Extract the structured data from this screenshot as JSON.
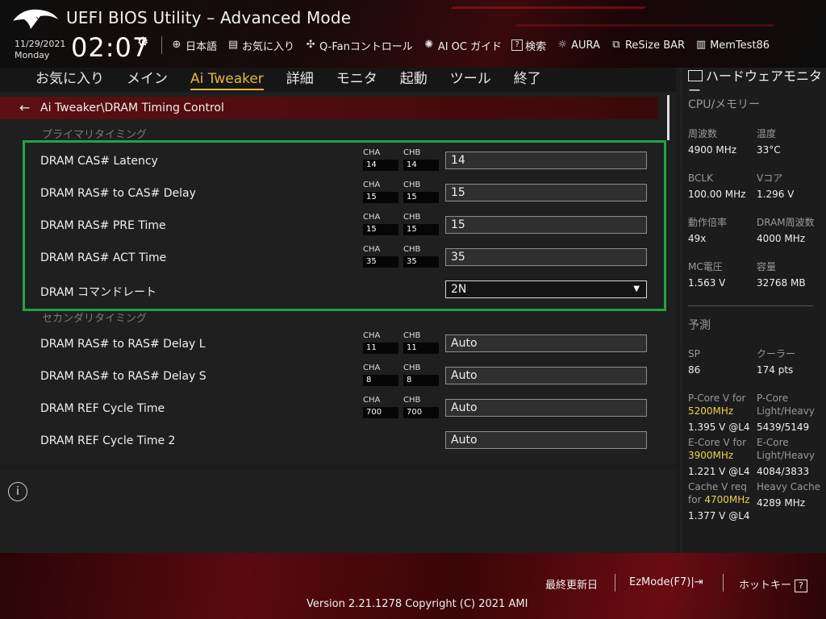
{
  "header": {
    "title": "UEFI BIOS Utility – Advanced Mode",
    "date": "11/29/2021",
    "day": "Monday",
    "time": "02:07",
    "quick": [
      {
        "icon": "globe-icon",
        "label": "日本語"
      },
      {
        "icon": "favorites-icon",
        "label": "お気に入り"
      },
      {
        "icon": "fan-icon",
        "label": "Q-Fanコントロール"
      },
      {
        "icon": "ai-oc-icon",
        "label": "AI OC ガイド"
      },
      {
        "icon": "help-icon",
        "label": "検索"
      },
      {
        "icon": "aura-icon",
        "label": "AURA"
      },
      {
        "icon": "resize-bar-icon",
        "label": "ReSize BAR"
      },
      {
        "icon": "memtest-icon",
        "label": "MemTest86"
      }
    ]
  },
  "menu": [
    "お気に入り",
    "メイン",
    "Ai Tweaker",
    "詳細",
    "モニタ",
    "起動",
    "ツール",
    "終了"
  ],
  "active_menu": "Ai Tweaker",
  "breadcrumb": "Ai Tweaker\\DRAM Timing Control",
  "sections": {
    "primary": "プライマリタイミング",
    "secondary": "セカンダリタイミング"
  },
  "rows": [
    {
      "label": "DRAM CAS# Latency",
      "cha": "14",
      "chb": "14",
      "value": "14"
    },
    {
      "label": "DRAM RAS# to CAS# Delay",
      "cha": "15",
      "chb": "15",
      "value": "15"
    },
    {
      "label": "DRAM RAS# PRE Time",
      "cha": "15",
      "chb": "15",
      "value": "15"
    },
    {
      "label": "DRAM RAS# ACT Time",
      "cha": "35",
      "chb": "35",
      "value": "35"
    },
    {
      "label": "DRAM コマンドレート",
      "value": "2N"
    },
    {
      "label": "DRAM RAS# to RAS# Delay L",
      "cha": "11",
      "chb": "11",
      "value": "Auto"
    },
    {
      "label": "DRAM RAS# to RAS# Delay S",
      "cha": "8",
      "chb": "8",
      "value": "Auto"
    },
    {
      "label": "DRAM REF Cycle Time",
      "cha": "700",
      "chb": "700",
      "value": "Auto"
    },
    {
      "label": "DRAM REF Cycle Time 2",
      "value": "Auto"
    }
  ],
  "channel_labels": {
    "a": "CHA",
    "b": "CHB"
  },
  "monitor": {
    "title": "ハードウェアモニター",
    "cpu_mem": "CPU/メモリー",
    "freq_label": "周波数",
    "freq": "4900 MHz",
    "temp_label": "温度",
    "temp": "33°C",
    "bclk_label": "BCLK",
    "bclk": "100.00 MHz",
    "vcore_label": "Vコア",
    "vcore": "1.296 V",
    "ratio_label": "動作倍率",
    "ratio": "49x",
    "dram_freq_label": "DRAM周波数",
    "dram_freq": "4000 MHz",
    "mc_volt_label": "MC電圧",
    "mc_volt": "1.563 V",
    "capacity_label": "容量",
    "capacity": "32768 MB",
    "prediction": "予測",
    "sp_label": "SP",
    "sp": "86",
    "cooler_label": "クーラー",
    "cooler": "174 pts",
    "pcore_v_label": "P-Core V for",
    "pcore_v_freq": "5200MHz",
    "pcore_v": "1.395 V @L4",
    "pcore_lh_label": "P-Core",
    "pcore_lh_sub": "Light/Heavy",
    "pcore_lh": "5439/5149",
    "ecore_v_label": "E-Core V for",
    "ecore_v_freq": "3900MHz",
    "ecore_v": "1.221 V @L4",
    "ecore_lh_label": "E-Core",
    "ecore_lh_sub": "Light/Heavy",
    "ecore_lh": "4084/3833",
    "cache_v_label": "Cache V req",
    "cache_v_for": "for",
    "cache_v_freq": "4700MHz",
    "cache_v": "1.377 V @L4",
    "heavy_cache_label": "Heavy Cache",
    "heavy_cache": "4289 MHz"
  },
  "footer": {
    "last_modified": "最終更新日",
    "ezmode": "EzMode(F7)",
    "hotkeys": "ホットキー",
    "hotkey_key": "?",
    "version": "Version 2.21.1278 Copyright (C) 2021 AMI"
  }
}
